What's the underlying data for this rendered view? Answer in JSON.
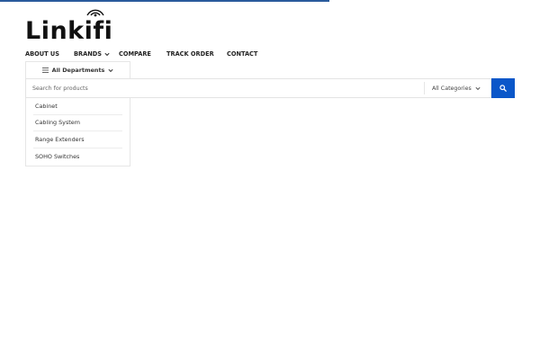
{
  "page": {
    "load_progress": 0.61
  },
  "brand": {
    "logo_text": "Linkifi"
  },
  "nav": {
    "items": [
      {
        "label": "ABOUT US",
        "has_dropdown": false
      },
      {
        "label": "BRANDS",
        "has_dropdown": true
      },
      {
        "label": "COMPARE",
        "has_dropdown": false
      },
      {
        "label": "TRACK ORDER",
        "has_dropdown": false
      },
      {
        "label": "CONTACT",
        "has_dropdown": false
      }
    ]
  },
  "departments": {
    "label": "All Departments",
    "icon": "hamburger-menu-icon",
    "items": [
      {
        "label": "Cabinet"
      },
      {
        "label": "Cabling System"
      },
      {
        "label": "Range Extenders"
      },
      {
        "label": "SOHO Switches"
      }
    ]
  },
  "search": {
    "placeholder": "Search for products",
    "value": "",
    "category_selected": "All Categories",
    "button_icon": "search-icon"
  },
  "colors": {
    "accent": "#0a57c9",
    "progress": "#2a5b9c",
    "text": "#333e48"
  }
}
